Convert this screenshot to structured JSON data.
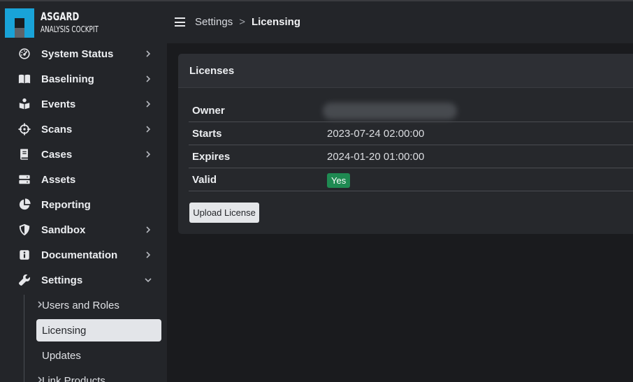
{
  "brand": {
    "title": "ASGARD",
    "subtitle": "ANALYSIS COCKPIT"
  },
  "sidebar": {
    "items": [
      {
        "label": "System Status",
        "icon": "gauge-icon",
        "has_chevron": true
      },
      {
        "label": "Baselining",
        "icon": "book-icon",
        "has_chevron": true
      },
      {
        "label": "Events",
        "icon": "reader-icon",
        "has_chevron": true
      },
      {
        "label": "Scans",
        "icon": "crosshairs-icon",
        "has_chevron": true
      },
      {
        "label": "Cases",
        "icon": "notebook-icon",
        "has_chevron": true
      },
      {
        "label": "Assets",
        "icon": "server-icon",
        "has_chevron": false
      },
      {
        "label": "Reporting",
        "icon": "pie-chart-icon",
        "has_chevron": false
      },
      {
        "label": "Sandbox",
        "icon": "shield-icon",
        "has_chevron": true
      },
      {
        "label": "Documentation",
        "icon": "info-icon",
        "has_chevron": true
      },
      {
        "label": "Settings",
        "icon": "wrench-icon",
        "has_chevron": true,
        "expanded": true
      }
    ],
    "settings_children": [
      {
        "label": "Users and Roles",
        "has_chevron": true
      },
      {
        "label": "Licensing",
        "active": true
      },
      {
        "label": "Updates"
      },
      {
        "label": "Link Products",
        "has_chevron": true
      }
    ]
  },
  "header": {
    "breadcrumb": {
      "parent": "Settings",
      "separator": ">",
      "current": "Licensing"
    }
  },
  "license_card": {
    "title": "Licenses",
    "rows": [
      {
        "key": "Owner",
        "value": ""
      },
      {
        "key": "Starts",
        "value": "2023-07-24 02:00:00"
      },
      {
        "key": "Expires",
        "value": "2024-01-20 01:00:00"
      },
      {
        "key": "Valid",
        "value": "Yes"
      }
    ],
    "upload_label": "Upload License"
  },
  "colors": {
    "accent": "#19a3d8",
    "valid_badge": "#1f8a52",
    "sidebar_bg": "#232529",
    "page_bg": "#1a1b1e"
  }
}
